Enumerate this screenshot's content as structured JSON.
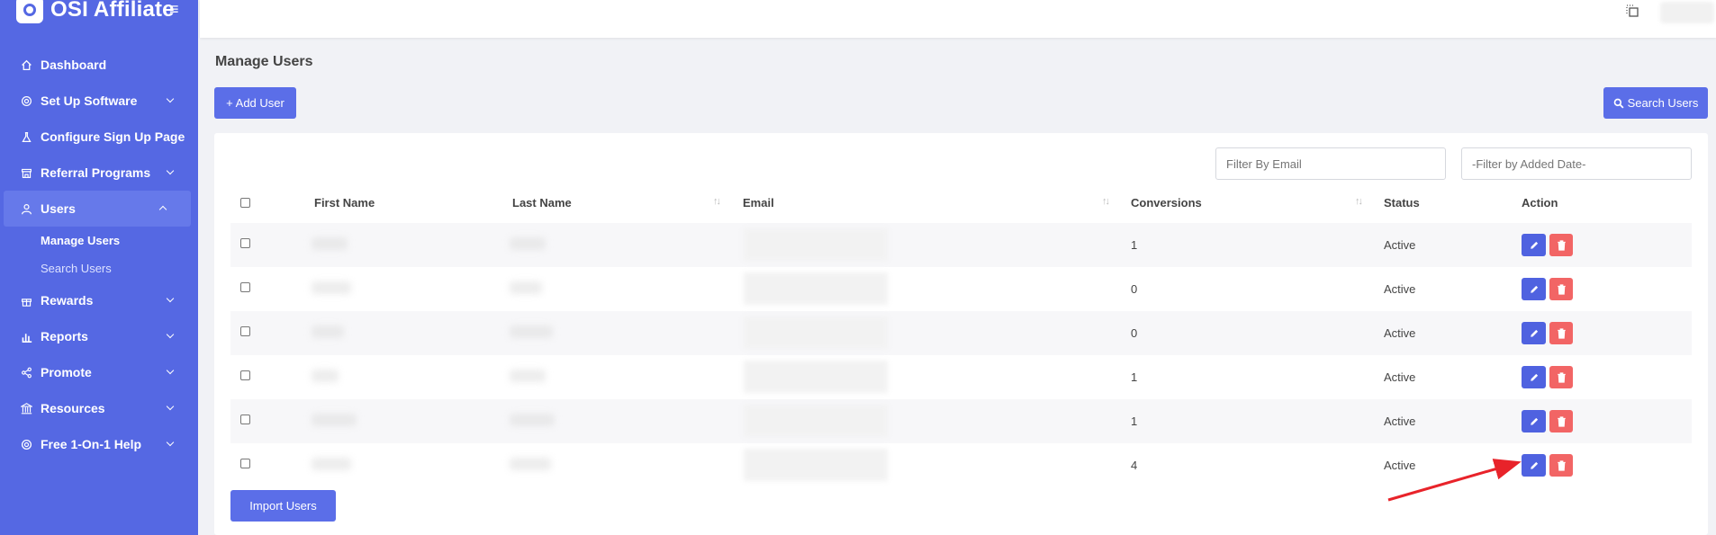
{
  "brand": {
    "name": "OSI Affiliate"
  },
  "sidebar": {
    "items": [
      {
        "label": "Dashboard",
        "icon": "home-icon"
      },
      {
        "label": "Set Up Software",
        "icon": "target-icon"
      },
      {
        "label": "Configure Sign Up Page",
        "icon": "flask-icon"
      },
      {
        "label": "Referral Programs",
        "icon": "store-icon"
      },
      {
        "label": "Users",
        "icon": "user-icon"
      },
      {
        "label": "Rewards",
        "icon": "gift-icon"
      },
      {
        "label": "Reports",
        "icon": "chart-icon"
      },
      {
        "label": "Promote",
        "icon": "share-icon"
      },
      {
        "label": "Resources",
        "icon": "bank-icon"
      },
      {
        "label": "Free 1-On-1 Help",
        "icon": "lifebuoy-icon"
      }
    ],
    "users_sub": [
      {
        "label": "Manage Users"
      },
      {
        "label": "Search Users"
      }
    ]
  },
  "page": {
    "title": "Manage Users",
    "add_user": "+ Add User",
    "search_users": "Search Users",
    "import_users": "Import Users",
    "filter_email_placeholder": "Filter By Email",
    "filter_date_placeholder": "-Filter by Added Date-"
  },
  "table": {
    "headers": {
      "first_name": "First Name",
      "last_name": "Last Name",
      "email": "Email",
      "conversions": "Conversions",
      "status": "Status",
      "action": "Action"
    },
    "rows": [
      {
        "conversions": "1",
        "status": "Active"
      },
      {
        "conversions": "0",
        "status": "Active"
      },
      {
        "conversions": "0",
        "status": "Active"
      },
      {
        "conversions": "1",
        "status": "Active"
      },
      {
        "conversions": "1",
        "status": "Active"
      },
      {
        "conversions": "4",
        "status": "Active"
      }
    ]
  },
  "colors": {
    "sidebar": "#5568e3",
    "primary": "#5b6ee8",
    "danger": "#f26565",
    "annotation_arrow": "#e8232a"
  }
}
